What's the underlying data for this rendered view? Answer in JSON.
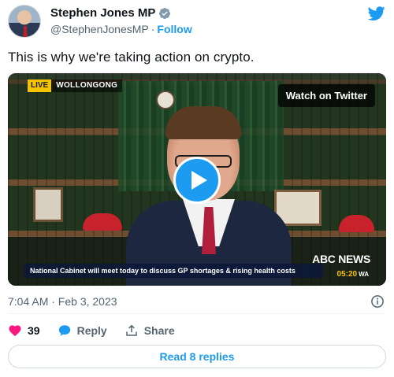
{
  "author": {
    "display_name": "Stephen Jones MP",
    "handle": "@StephenJonesMP",
    "separator": "·",
    "follow_label": "Follow"
  },
  "tweet": {
    "text": "This is why we're taking action on crypto.",
    "timestamp": "7:04 AM · Feb 3, 2023"
  },
  "video": {
    "live_label": "LIVE",
    "location": "WOLLONGONG",
    "watch_label": "Watch on Twitter",
    "ticker": "National Cabinet will meet today to discuss GP shortages & rising health costs",
    "network": "ABC NEWS",
    "time": "05:20",
    "timezone": "WA"
  },
  "actions": {
    "like_count": "39",
    "reply_label": "Reply",
    "share_label": "Share"
  },
  "read_replies_label": "Read 8 replies",
  "colors": {
    "accent": "#1d9bf0",
    "heart": "#f91880",
    "text": "#0f1419",
    "muted": "#536471"
  }
}
